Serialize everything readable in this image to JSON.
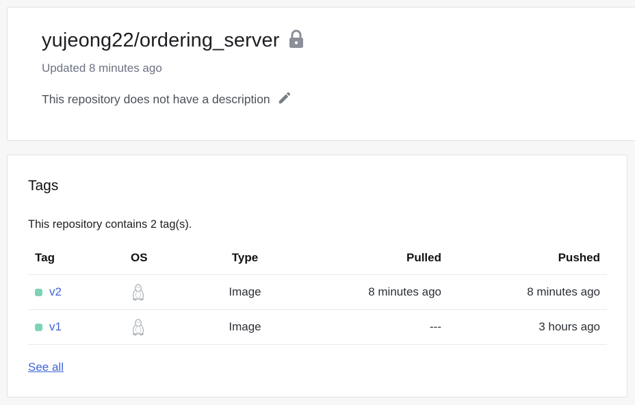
{
  "repo": {
    "name": "yujeong22/ordering_server",
    "privacy_icon": "lock-icon",
    "updated": "Updated 8 minutes ago",
    "description": "This repository does not have a description",
    "edit_icon": "pencil-icon"
  },
  "tags_section": {
    "title": "Tags",
    "count_text": "This repository contains 2 tag(s).",
    "columns": {
      "tag": "Tag",
      "os": "OS",
      "type": "Type",
      "pulled": "Pulled",
      "pushed": "Pushed"
    },
    "rows": [
      {
        "tag": "v2",
        "os_icon": "linux-icon",
        "type": "Image",
        "pulled": "8 minutes ago",
        "pushed": "8 minutes ago"
      },
      {
        "tag": "v1",
        "os_icon": "linux-icon",
        "type": "Image",
        "pulled": "---",
        "pushed": "3 hours ago"
      }
    ],
    "see_all": "See all"
  },
  "colors": {
    "accent_link": "#3a64d8",
    "status_dot": "#7dd3b6",
    "muted_text": "#6b7280",
    "icon_gray": "#7a7f87"
  }
}
